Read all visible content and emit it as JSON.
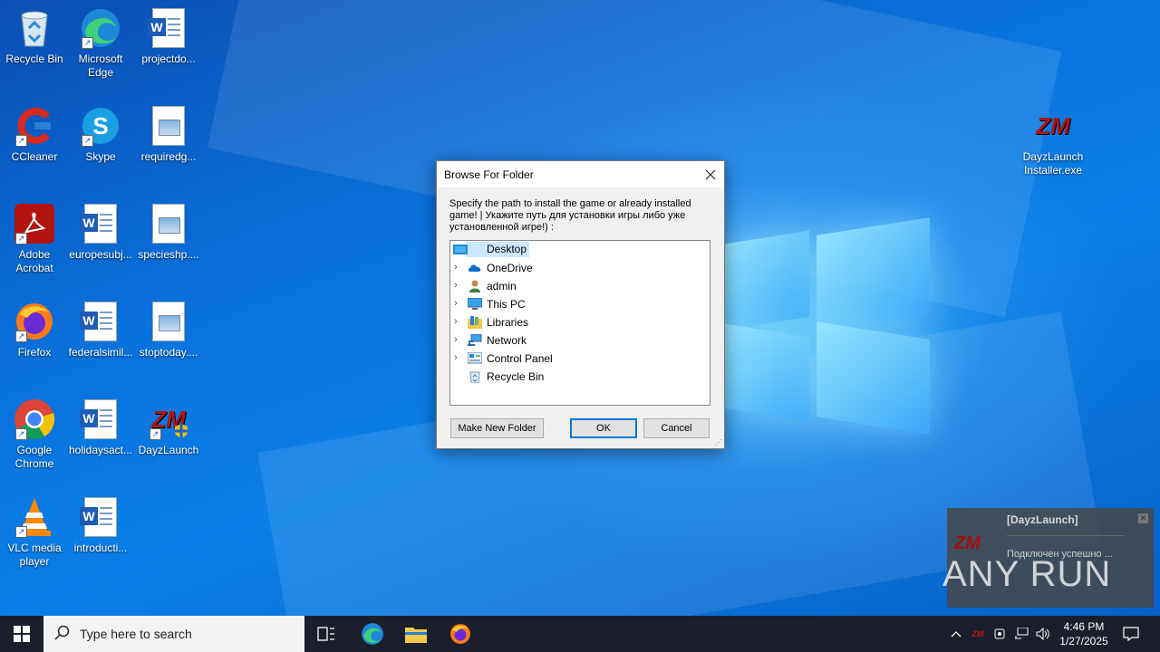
{
  "desktop": {
    "icons": [
      {
        "label": "Recycle Bin"
      },
      {
        "label": "Microsoft Edge"
      },
      {
        "label": "projectdo..."
      },
      {
        "label": "CCleaner"
      },
      {
        "label": "Skype"
      },
      {
        "label": "requiredg..."
      },
      {
        "label": "Adobe Acrobat"
      },
      {
        "label": "europesubj..."
      },
      {
        "label": "specieshp...."
      },
      {
        "label": "Firefox"
      },
      {
        "label": "federalsimil..."
      },
      {
        "label": "stoptoday...."
      },
      {
        "label": "Google Chrome"
      },
      {
        "label": "holidaysact..."
      },
      {
        "label": "DayzLaunch"
      },
      {
        "label": "VLC media player"
      },
      {
        "label": "introducti..."
      },
      {
        "label": "DayzLaunch Installer.exe"
      }
    ]
  },
  "dialog": {
    "title": "Browse For Folder",
    "description": "Specify the path to install the game or already installed game! | Укажите путь для установки игры либо уже установленной игре!) :",
    "tree": [
      {
        "label": "Desktop",
        "icon": "desktop-icon",
        "selected": true
      },
      {
        "label": "OneDrive",
        "icon": "onedrive-icon"
      },
      {
        "label": "admin",
        "icon": "user-icon"
      },
      {
        "label": "This PC",
        "icon": "computer-icon"
      },
      {
        "label": "Libraries",
        "icon": "libraries-icon"
      },
      {
        "label": "Network",
        "icon": "network-icon"
      },
      {
        "label": "Control Panel",
        "icon": "control-panel-icon"
      },
      {
        "label": "Recycle Bin",
        "icon": "recycle-bin-icon"
      }
    ],
    "buttons": {
      "new_folder": "Make New Folder",
      "ok": "OK",
      "cancel": "Cancel"
    }
  },
  "notification": {
    "title": "[DayzLaunch]",
    "message": "Подключен успешно ...",
    "logo_text": "ZM"
  },
  "watermark": "ANY RUN",
  "taskbar": {
    "search_placeholder": "Type here to search",
    "time": "4:46 PM",
    "date": "1/27/2025"
  },
  "colors": {
    "accent": "#0078d7",
    "selection": "#cce8ff",
    "taskbar": "#1a1f2b"
  }
}
